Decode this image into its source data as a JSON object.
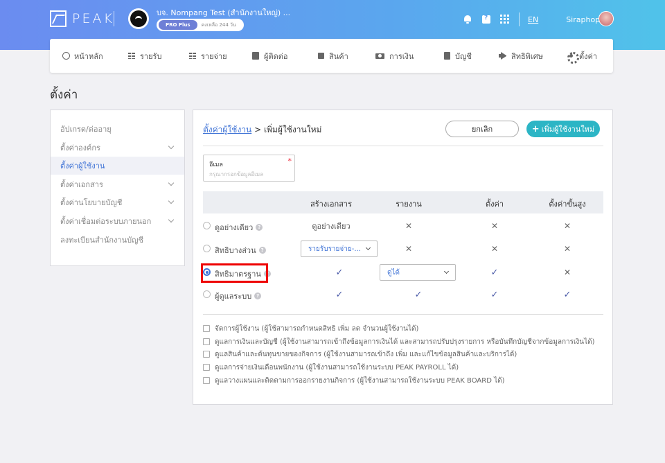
{
  "header": {
    "logo_text": "PEAK",
    "org_name": "บจ. Nompang Test (สำนักงานใหญ่) ...",
    "plan_badge": "PRO Plus",
    "plan_remaining": "คงเหลือ 244 วัน",
    "lang": "EN",
    "user_name": "Siraphop"
  },
  "nav": {
    "items": [
      {
        "label": "หน้าหลัก",
        "icon": "home-icon"
      },
      {
        "label": "รายรับ",
        "icon": "list-icon"
      },
      {
        "label": "รายจ่าย",
        "icon": "list-icon"
      },
      {
        "label": "ผู้ติดต่อ",
        "icon": "contact-icon"
      },
      {
        "label": "สินค้า",
        "icon": "box-icon"
      },
      {
        "label": "การเงิน",
        "icon": "money-icon"
      },
      {
        "label": "บัญชี",
        "icon": "book-icon"
      },
      {
        "label": "สิทธิพิเศษ",
        "icon": "megaphone-icon"
      },
      {
        "label": "ตั้งค่า",
        "icon": "gear-icon"
      }
    ]
  },
  "page": {
    "title": "ตั้งค่า"
  },
  "sidebar": {
    "items": [
      {
        "label": "อัปเกรด/ต่ออายุ"
      },
      {
        "label": "ตั้งค่าองค์กร"
      },
      {
        "label": "ตั้งค่าผู้ใช้งาน"
      },
      {
        "label": "ตั้งค่าเอกสาร"
      },
      {
        "label": "ตั้งค่านโยบายบัญชี"
      },
      {
        "label": "ตั้งค่าเชื่อมต่อระบบภายนอก"
      },
      {
        "label": "ลงทะเบียนสำนักงานบัญชี"
      }
    ]
  },
  "main": {
    "breadcrumb_link": "ตั้งค่าผู้ใช้งาน",
    "breadcrumb_rest": " > เพิ่มผู้ใช้งานใหม่",
    "cancel_label": "ยกเลิก",
    "add_label": "เพิ่มผู้ใช้งานใหม่",
    "email_label": "อีเมล",
    "email_required": "*",
    "email_value": "",
    "email_placeholder": "กรุณากรอกข้อมูลอีเมล",
    "columns": [
      "สร้างเอกสาร",
      "รายงาน",
      "ตั้งค่า",
      "ตั้งค่าขั้นสูง"
    ],
    "roles": [
      {
        "label": "ดูอย่างเดียว",
        "doc": "ดูอย่างเดียว",
        "report": "✕",
        "settings": "✕",
        "advanced": "✕"
      },
      {
        "label": "สิทธิบางส่วน",
        "doc_select": "รายรับรายจ่าย-...",
        "report": "✕",
        "settings": "✕",
        "advanced": "✕"
      },
      {
        "label": "สิทธิมาตรฐาน",
        "doc": "✓",
        "report_select": "ดูได้",
        "settings": "✓",
        "advanced": "✕"
      },
      {
        "label": "ผู้ดูแลระบบ",
        "doc": "✓",
        "report": "✓",
        "settings": "✓",
        "advanced": "✓"
      }
    ],
    "help_glyph": "?",
    "permissions": [
      "จัดการผู้ใช้งาน (ผู้ใช้สามารถกำหนดสิทธิ เพิ่ม ลด จำนวนผู้ใช้งานได้)",
      "ดูแลการเงินและบัญชี (ผู้ใช้งานสามารถเข้าถึงข้อมูลการเงินได้ และสามารถปรับปรุงรายการ หรือบันทึกบัญชีจากข้อมูลการเงินได้)",
      "ดูแลสินค้าและต้นทุนขายของกิจการ (ผู้ใช้งานสามารถเข้าถึง เพิ่ม และแก้ไขข้อมูลสินค้าและบริการได้)",
      "ดูแลการจ่ายเงินเดือนพนักงาน (ผู้ใช้งานสามารถใช้งานระบบ PEAK PAYROLL ได้)",
      "ดูแลวางแผนและติดตามการออกรายงานกิจการ (ผู้ใช้งานสามารถใช้งานระบบ PEAK BOARD ได้)"
    ]
  }
}
